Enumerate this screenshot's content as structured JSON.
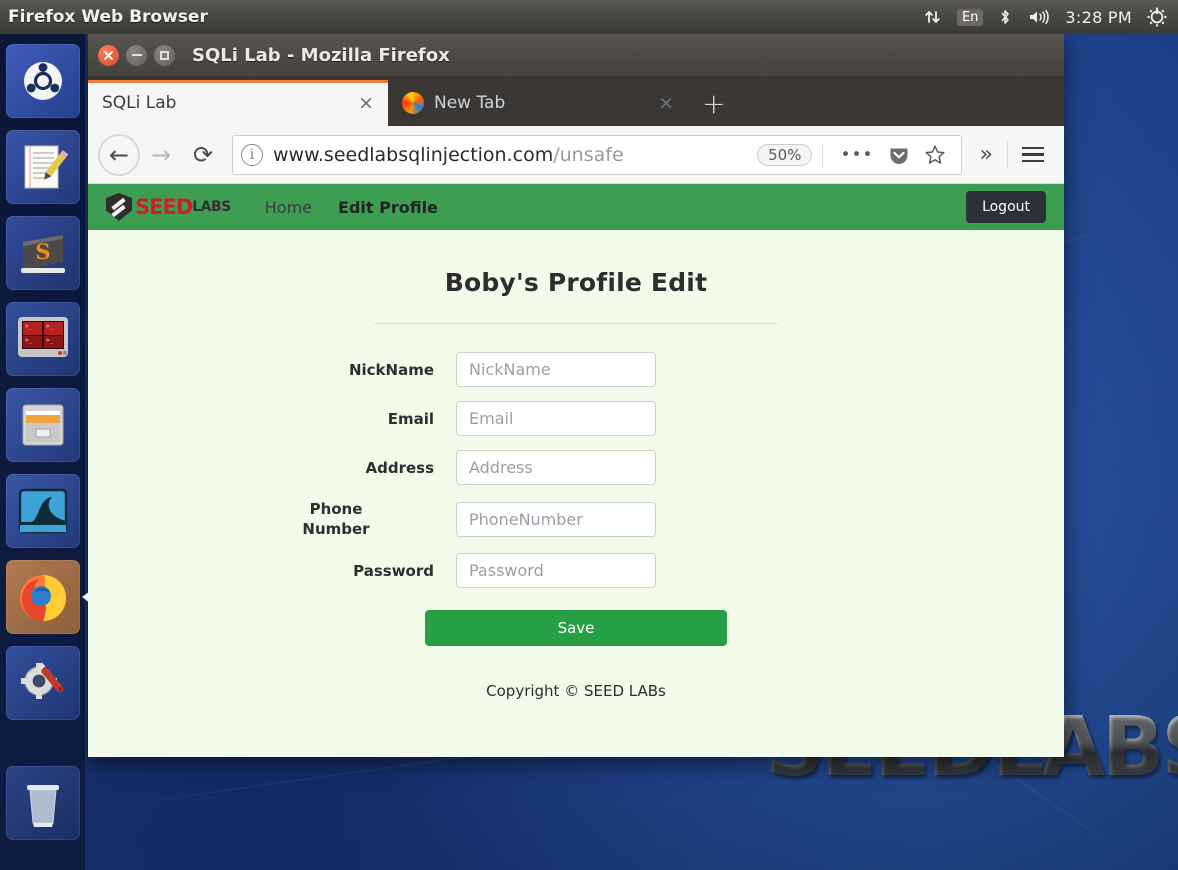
{
  "panel": {
    "title": "Firefox Web Browser",
    "tray": {
      "network_icon": "network-up-down-icon",
      "keyboard_layout": "En",
      "bluetooth_icon": "bluetooth-icon",
      "volume_icon": "volume-icon",
      "clock": "3:28 PM",
      "power_icon": "power-gear-icon"
    }
  },
  "launcher": {
    "items": [
      {
        "name": "ubuntu-dash",
        "label": "Ubuntu Dash"
      },
      {
        "name": "text-editor",
        "label": "Text Editor"
      },
      {
        "name": "sublime-text",
        "label": "Sublime Text"
      },
      {
        "name": "terminal",
        "label": "Terminal"
      },
      {
        "name": "files",
        "label": "Files"
      },
      {
        "name": "wireshark",
        "label": "Wireshark"
      },
      {
        "name": "firefox",
        "label": "Firefox Web Browser"
      },
      {
        "name": "system-settings",
        "label": "System Settings"
      },
      {
        "name": "trash",
        "label": "Trash"
      }
    ]
  },
  "desktop": {
    "wallpaper_text": "SEEDLABS"
  },
  "window": {
    "title": "SQLi Lab - Mozilla Firefox",
    "controls": {
      "close": "×",
      "minimize": "–",
      "maximize": "□"
    }
  },
  "tabs": [
    {
      "label": "SQLi Lab",
      "close": "×",
      "active": true
    },
    {
      "label": "New Tab",
      "close": "×",
      "active": false
    }
  ],
  "newtab_button": "+",
  "navbar": {
    "back_icon": "←",
    "forward_icon": "→",
    "reload_icon": "⟳",
    "info_icon": "i",
    "url_main": "www.seedlabsqlinjection.com",
    "url_path": "/unsafe",
    "zoom_level": "50%",
    "page_actions_icon": "•••",
    "pocket_icon": "pocket-icon",
    "bookmark_icon": "star-icon",
    "overflow_icon": "»",
    "menu_icon": "hamburger-icon"
  },
  "site": {
    "brand_seed": "SEED",
    "brand_labs": "LABS",
    "nav": [
      {
        "label": "Home",
        "active": false
      },
      {
        "label": "Edit Profile",
        "active": true
      }
    ],
    "logout_label": "Logout",
    "page_title": "Boby's Profile Edit",
    "fields": [
      {
        "label": "NickName",
        "placeholder": "NickName",
        "value": "",
        "two_line": false
      },
      {
        "label": "Email",
        "placeholder": "Email",
        "value": "",
        "two_line": false
      },
      {
        "label": "Address",
        "placeholder": "Address",
        "value": "",
        "two_line": false
      },
      {
        "label": "Phone\nNumber",
        "placeholder": "PhoneNumber",
        "value": "",
        "two_line": true
      },
      {
        "label": "Password",
        "placeholder": "Password",
        "value": "",
        "two_line": false
      }
    ],
    "save_label": "Save",
    "copyright": "Copyright © SEED LABs"
  },
  "colors": {
    "navbar_green": "#3d9e52",
    "page_bg": "#f2faea",
    "save_green": "#26a045",
    "logout_dark": "#2b3138",
    "brand_red": "#cf1f24",
    "tab_accent": "#ef7c3c"
  }
}
